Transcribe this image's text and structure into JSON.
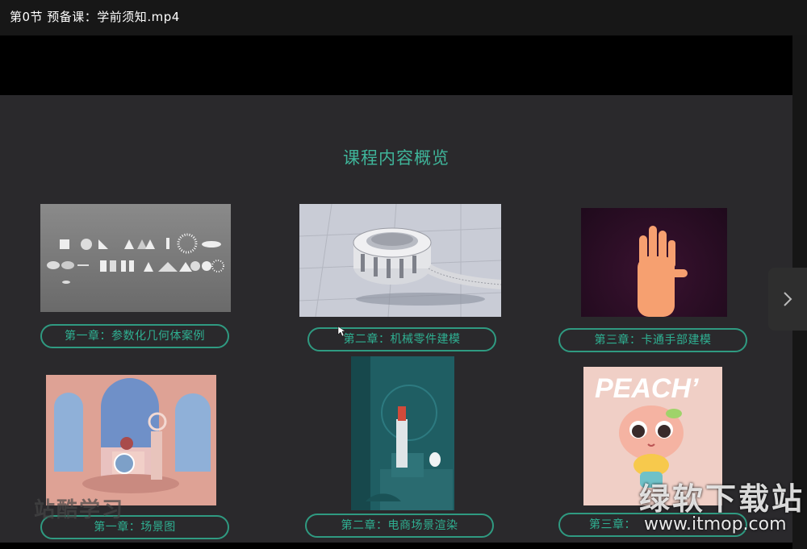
{
  "window": {
    "title": "第0节 预备课：学前须知.mp4"
  },
  "slide": {
    "title": "课程内容概览",
    "cards": [
      {
        "label": "第一章：参数化几何体案例"
      },
      {
        "label": "第二章：机械零件建模"
      },
      {
        "label": "第三章：卡通手部建模"
      },
      {
        "label": "第一章：场景图"
      },
      {
        "label": "第二章：电商场景渲染"
      },
      {
        "label": "第三章："
      }
    ],
    "peach_text": "PEACH’"
  },
  "watermark": {
    "site_cn": "绿软下载站",
    "site_url": "www.itmop.com",
    "overlay_left": "站酷学习"
  },
  "icons": {
    "next": "chevron-right-icon",
    "cursor": "mouse-cursor-icon"
  }
}
